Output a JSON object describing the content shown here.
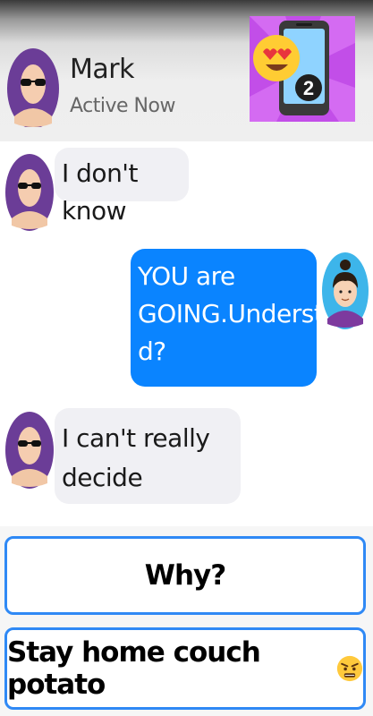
{
  "contact": {
    "name": "Mark",
    "status": "Active Now"
  },
  "app_badge": {
    "number": "2"
  },
  "messages": [
    {
      "from": "Mark",
      "side": "left",
      "lines": [
        "I don't know"
      ]
    },
    {
      "from": "me",
      "side": "right",
      "lines": [
        "YOU are",
        "GOING.Understan",
        "d?"
      ]
    },
    {
      "from": "Mark",
      "side": "left",
      "lines": [
        "I can't really",
        "decide"
      ]
    }
  ],
  "choices": [
    {
      "label": "Why?"
    },
    {
      "label": "Stay home couch potato",
      "icon": "angry-face-icon"
    }
  ],
  "colors": {
    "outgoing_bubble": "#0a84ff",
    "incoming_bubble": "#f0f0f4",
    "choice_border": "#2f89f5",
    "avatar_purple": "#6b3d97"
  }
}
